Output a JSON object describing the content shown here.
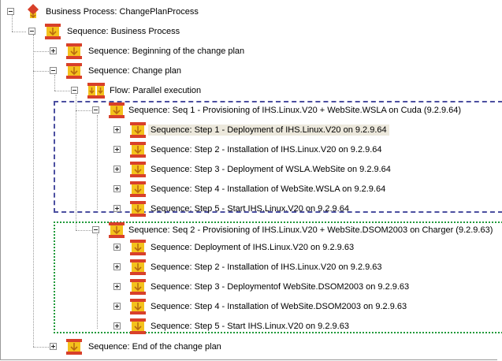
{
  "tree": {
    "root": {
      "label": "Business Process: ChangePlanProcess",
      "icon": "business-process-icon"
    },
    "sequence_business_process": {
      "label": "Sequence: Business Process",
      "icon": "sequence-icon"
    },
    "beginning": {
      "label": "Sequence: Beginning of the change plan",
      "icon": "sequence-icon"
    },
    "change_plan": {
      "label": "Sequence: Change plan",
      "icon": "sequence-icon"
    },
    "flow": {
      "label": "Flow: Parallel execution",
      "icon": "flow-icon"
    },
    "seq1": {
      "label": "Sequence: Seq 1 - Provisioning of IHS.Linux.V20 + WebSite.WSLA on Cuda (9.2.9.64)",
      "icon": "sequence-icon",
      "steps": [
        {
          "label": "Sequence: Step 1 - Deployment of IHS.Linux.V20 on 9.2.9.64",
          "selected": true
        },
        {
          "label": "Sequence: Step 2 - Installation of IHS.Linux.V20 on 9.2.9.64"
        },
        {
          "label": "Sequence: Step 3 - Deployment of WSLA.WebSite on 9.2.9.64"
        },
        {
          "label": "Sequence: Step 4 - Installation of WebSite.WSLA on 9.2.9.64"
        },
        {
          "label": "Sequence: Step 5 - Start IHS.Linux.V20 on 9.2.9.64"
        }
      ]
    },
    "seq2": {
      "label": "Sequence: Seq 2 - Provisioning of IHS.Linux.V20 + WebSite.DSOM2003 on Charger (9.2.9.63)",
      "icon": "sequence-icon",
      "steps": [
        {
          "label": "Sequence: Deployment of IHS.Linux.V20 on 9.2.9.63"
        },
        {
          "label": "Sequence: Step 2 - Installation of IHS.Linux.V20 on 9.2.9.63"
        },
        {
          "label": "Sequence: Step 3 - Deploymentof WebSite.DSOM2003 on 9.2.9.63"
        },
        {
          "label": "Sequence: Step 4 - Installation of WebSite.DSOM2003 on 9.2.9.63"
        },
        {
          "label": "Sequence: Step 5 - Start IHS.Linux.V20 on 9.2.9.63"
        }
      ]
    },
    "end": {
      "label": "Sequence: End of the change plan",
      "icon": "sequence-icon"
    }
  },
  "colors": {
    "icon_red": "#d8402a",
    "icon_yellow": "#f4c21c",
    "icon_arrow": "#b86a10",
    "seq1_box": "#4b4fa0",
    "seq2_box": "#1f9a3a",
    "selection": "#ece8dc",
    "tree_lines": "#9a9a9a"
  }
}
